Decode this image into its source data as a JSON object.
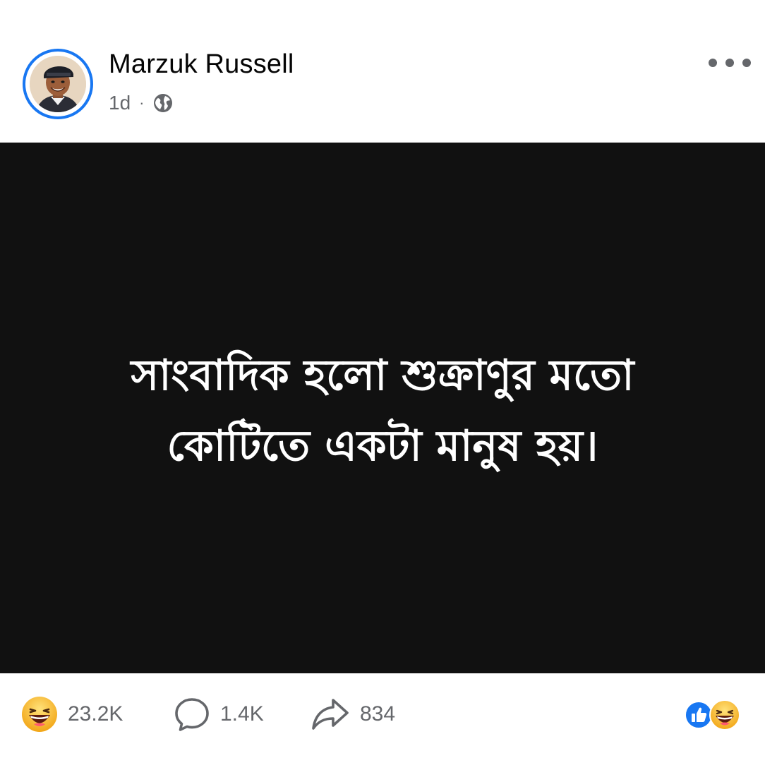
{
  "post": {
    "author": {
      "name": "Marzuk Russell",
      "avatar_icon": "profile-avatar"
    },
    "meta": {
      "time": "1d",
      "separator": "·",
      "audience_icon": "globe-icon"
    },
    "menu_icon": "more-horizontal-icon",
    "content": {
      "line1": "সাংবাদিক হলো শুক্রাণুর মতো",
      "line2": "কোটিতে একটা মানুষ হয়।",
      "background": "#111111",
      "text_color": "#ffffff"
    },
    "stats": {
      "reactions": "23.2K",
      "comments": "1.4K",
      "shares": "834"
    },
    "icons": {
      "reaction": "haha-emoji-icon",
      "comment": "comment-bubble-icon",
      "share": "share-arrow-icon",
      "reaction_summary": [
        "like-icon",
        "haha-icon"
      ]
    },
    "colors": {
      "accent": "#1877f2",
      "secondary_text": "#65676b",
      "emoji_yellow": "#f7b125"
    }
  }
}
